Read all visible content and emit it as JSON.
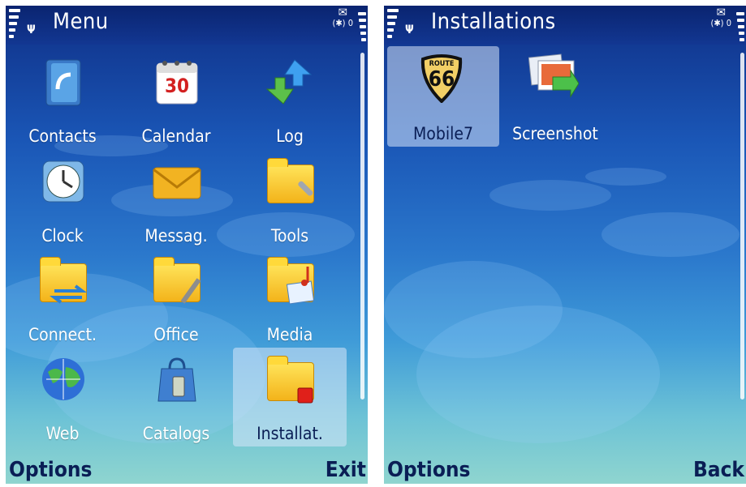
{
  "left": {
    "title": "Menu",
    "softkeys": {
      "left": "Options",
      "right": "Exit"
    },
    "items": [
      {
        "label": "Contacts",
        "icon": "contacts-icon"
      },
      {
        "label": "Calendar",
        "icon": "calendar-icon",
        "day": "30"
      },
      {
        "label": "Log",
        "icon": "log-icon"
      },
      {
        "label": "Clock",
        "icon": "clock-icon"
      },
      {
        "label": "Messag.",
        "icon": "messaging-icon"
      },
      {
        "label": "Tools",
        "icon": "tools-folder-icon"
      },
      {
        "label": "Connect.",
        "icon": "connectivity-folder-icon"
      },
      {
        "label": "Office",
        "icon": "office-folder-icon"
      },
      {
        "label": "Media",
        "icon": "media-folder-icon"
      },
      {
        "label": "Web",
        "icon": "web-globe-icon"
      },
      {
        "label": "Catalogs",
        "icon": "catalogs-bag-icon"
      },
      {
        "label": "Installat.",
        "icon": "installations-folder-icon",
        "selected": true
      }
    ]
  },
  "right": {
    "title": "Installations",
    "softkeys": {
      "left": "Options",
      "right": "Back"
    },
    "items": [
      {
        "label": "Mobile7",
        "icon": "route66-icon",
        "badge_top": "ROUTE",
        "badge_num": "66",
        "selected": true
      },
      {
        "label": "Screenshot",
        "icon": "screenshot-icon"
      }
    ]
  },
  "status": {
    "bluetooth": "(✱)",
    "mode": "0",
    "envelope": "✉",
    "antenna": "Ψ"
  }
}
